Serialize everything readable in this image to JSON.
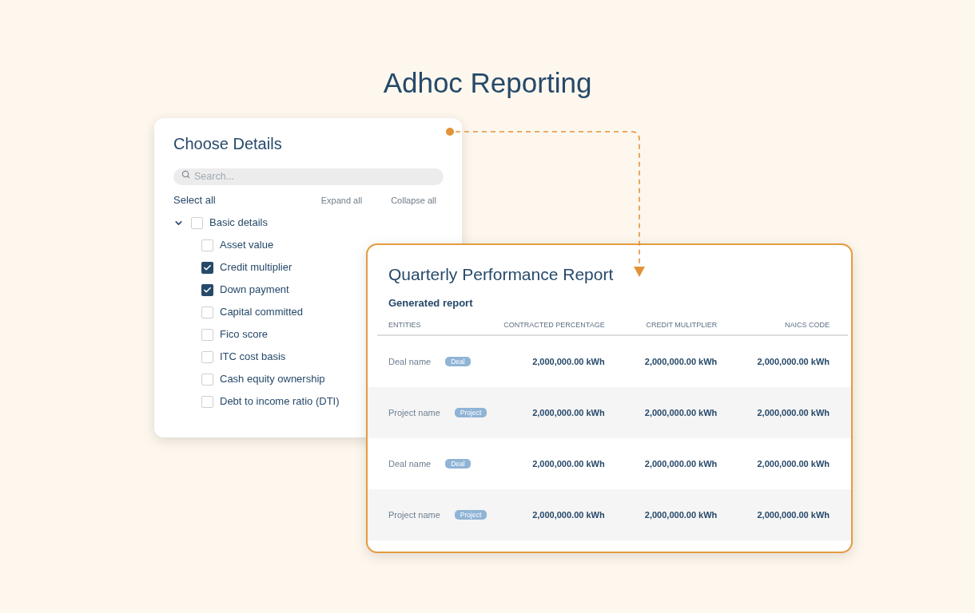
{
  "title": "Adhoc Reporting",
  "details_panel": {
    "title": "Choose Details",
    "search": {
      "placeholder": "Search..."
    },
    "select_all": "Select all",
    "expand_all": "Expand all",
    "collapse_all": "Collapse all",
    "tree": [
      {
        "label": "Basic details",
        "checked": false,
        "expanded": true,
        "children": [
          {
            "label": "Asset value",
            "checked": false
          },
          {
            "label": "Credit multiplier",
            "checked": true
          },
          {
            "label": "Down payment",
            "checked": true
          },
          {
            "label": "Capital committed",
            "checked": false
          },
          {
            "label": "Fico score",
            "checked": false
          },
          {
            "label": "ITC cost basis",
            "checked": false
          },
          {
            "label": "Cash equity ownership",
            "checked": false
          },
          {
            "label": "Debt to income ratio (DTI)",
            "checked": false
          }
        ]
      }
    ]
  },
  "report": {
    "title": "Quarterly Performance Report",
    "subtitle": "Generated report",
    "columns": [
      "ENTITIES",
      "CONTRACTED PERCENTAGE",
      "CREDIT MULITPLIER",
      "NAICS CODE"
    ],
    "rows": [
      {
        "name": "Deal name",
        "tag": "Deal",
        "values": [
          "2,000,000.00 kWh",
          "2,000,000.00 kWh",
          "2,000,000.00 kWh"
        ]
      },
      {
        "name": "Project name",
        "tag": "Project",
        "values": [
          "2,000,000.00 kWh",
          "2,000,000.00 kWh",
          "2,000,000.00 kWh"
        ]
      },
      {
        "name": "Deal name",
        "tag": "Deal",
        "values": [
          "2,000,000.00 kWh",
          "2,000,000.00 kWh",
          "2,000,000.00 kWh"
        ]
      },
      {
        "name": "Project name",
        "tag": "Project",
        "values": [
          "2,000,000.00 kWh",
          "2,000,000.00 kWh",
          "2,000,000.00 kWh"
        ]
      }
    ]
  }
}
